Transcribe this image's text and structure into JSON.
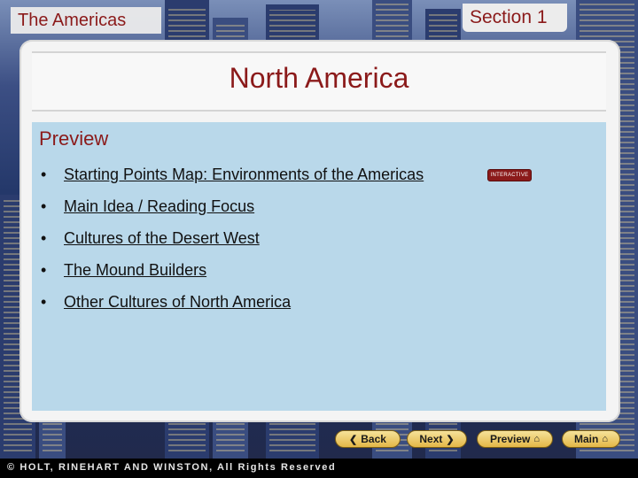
{
  "header": {
    "subject": "The Americas",
    "section": "Section 1"
  },
  "main": {
    "title": "North America",
    "section_label": "Preview",
    "items": [
      {
        "label": "Starting Points Map: Environments of the Americas ",
        "badge": "INTERACTIVE"
      },
      {
        "label": "Main Idea / Reading Focus"
      },
      {
        "label": "Cultures of the Desert West"
      },
      {
        "label": "The Mound Builders"
      },
      {
        "label": "Other Cultures of North America"
      }
    ]
  },
  "nav": {
    "back": "Back",
    "next": "Next",
    "preview": "Preview",
    "main": "Main"
  },
  "footer": {
    "copyright": "© HOLT, RINEHART AND WINSTON, All Rights Reserved"
  },
  "colors": {
    "accent": "#8b1a1a",
    "content_bg": "#b9d8ea",
    "button": "#e3b747"
  }
}
